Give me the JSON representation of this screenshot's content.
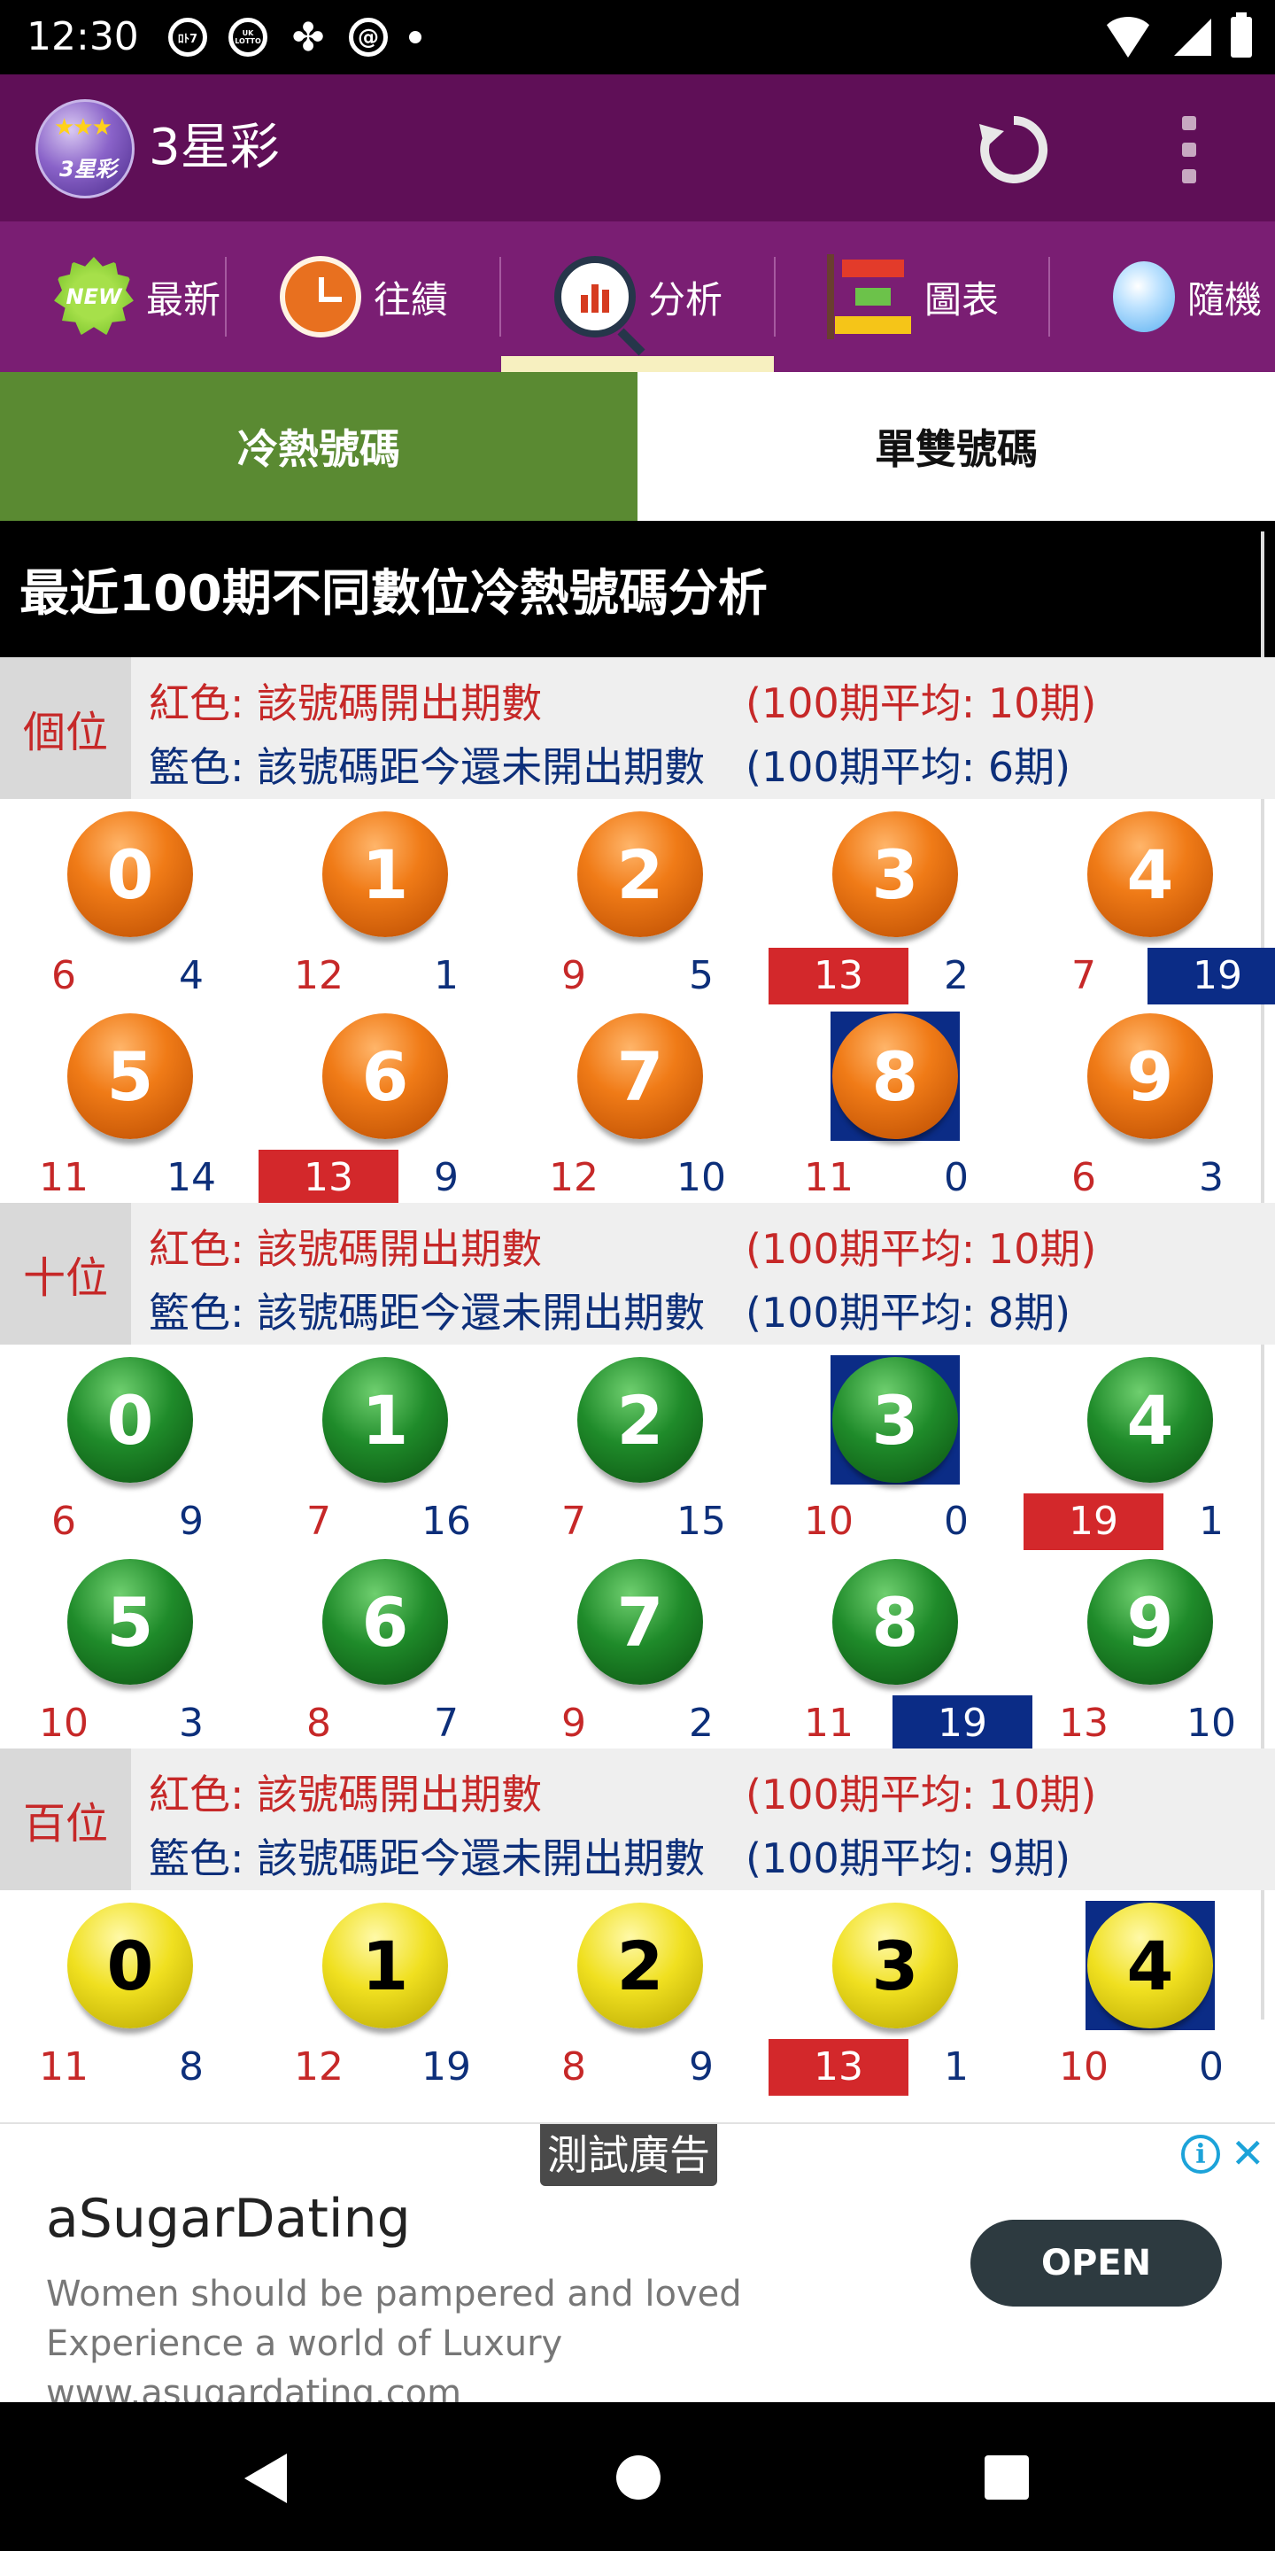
{
  "status": {
    "time": "12:30",
    "left_icons": [
      "lotto-jp-icon",
      "uk-lotto-icon",
      "clover-icon",
      "at-sign-icon",
      "dot-icon"
    ],
    "left_icon_texts": [
      "ﾛﾄ7",
      "UK LOTTO"
    ],
    "right_icons": [
      "wifi-icon",
      "signal-icon",
      "battery-icon"
    ]
  },
  "app_bar": {
    "logo_text": "3星彩",
    "title": "3星彩",
    "actions": [
      "refresh-icon",
      "more-vert-icon"
    ]
  },
  "tabs": [
    {
      "label": "最新",
      "icon": "new-badge-icon",
      "icon_text": "NEW"
    },
    {
      "label": "往績",
      "icon": "clock-icon"
    },
    {
      "label": "分析",
      "icon": "analysis-magnifier-icon",
      "selected": true
    },
    {
      "label": "圖表",
      "icon": "bar-chart-icon"
    },
    {
      "label": "隨機",
      "icon": "lightbulb-icon"
    }
  ],
  "subtabs": {
    "hot_cold": "冷熱號碼",
    "odd_even": "單雙號碼",
    "active": "hot_cold"
  },
  "section_title": "最近100期不同數位冷熱號碼分析",
  "colors": {
    "red": "#c62828",
    "blue": "#0d2f7a",
    "highlight_red": "#d3282b",
    "highlight_blue": "#0b2c86",
    "active_subtab": "#5a8a32",
    "app_bar": "#5f0f57",
    "tab_strip": "#7a1e73"
  },
  "positions": [
    {
      "label": "個位",
      "legend_red": "紅色: 該號碼開出期數",
      "legend_blue": "籃色: 該號碼距今還未開出期數",
      "avg_red": "(100期平均: 10期)",
      "avg_blue": "(100期平均: 6期)",
      "ball_color": "orange",
      "numbers": [
        {
          "digit": "0",
          "drawn": "6",
          "since": "4"
        },
        {
          "digit": "1",
          "drawn": "12",
          "since": "1"
        },
        {
          "digit": "2",
          "drawn": "9",
          "since": "5"
        },
        {
          "digit": "3",
          "drawn": "13",
          "since": "2",
          "hot": true
        },
        {
          "digit": "4",
          "drawn": "7",
          "since": "19",
          "cold": true
        },
        {
          "digit": "5",
          "drawn": "11",
          "since": "14"
        },
        {
          "digit": "6",
          "drawn": "13",
          "since": "9",
          "hot": true
        },
        {
          "digit": "7",
          "drawn": "12",
          "since": "10"
        },
        {
          "digit": "8",
          "drawn": "11",
          "since": "0",
          "latest": true
        },
        {
          "digit": "9",
          "drawn": "6",
          "since": "3"
        }
      ]
    },
    {
      "label": "十位",
      "legend_red": "紅色: 該號碼開出期數",
      "legend_blue": "籃色: 該號碼距今還未開出期數",
      "avg_red": "(100期平均: 10期)",
      "avg_blue": "(100期平均: 8期)",
      "ball_color": "green",
      "numbers": [
        {
          "digit": "0",
          "drawn": "6",
          "since": "9"
        },
        {
          "digit": "1",
          "drawn": "7",
          "since": "16"
        },
        {
          "digit": "2",
          "drawn": "7",
          "since": "15"
        },
        {
          "digit": "3",
          "drawn": "10",
          "since": "0",
          "latest": true
        },
        {
          "digit": "4",
          "drawn": "19",
          "since": "1",
          "hot": true
        },
        {
          "digit": "5",
          "drawn": "10",
          "since": "3"
        },
        {
          "digit": "6",
          "drawn": "8",
          "since": "7"
        },
        {
          "digit": "7",
          "drawn": "9",
          "since": "2"
        },
        {
          "digit": "8",
          "drawn": "11",
          "since": "19",
          "cold": true
        },
        {
          "digit": "9",
          "drawn": "13",
          "since": "10"
        }
      ]
    },
    {
      "label": "百位",
      "legend_red": "紅色: 該號碼開出期數",
      "legend_blue": "籃色: 該號碼距今還未開出期數",
      "avg_red": "(100期平均: 10期)",
      "avg_blue": "(100期平均: 9期)",
      "ball_color": "yellow",
      "numbers": [
        {
          "digit": "0",
          "drawn": "11",
          "since": "8"
        },
        {
          "digit": "1",
          "drawn": "12",
          "since": "19"
        },
        {
          "digit": "2",
          "drawn": "8",
          "since": "9"
        },
        {
          "digit": "3",
          "drawn": "13",
          "since": "1",
          "hot": true
        },
        {
          "digit": "4",
          "drawn": "10",
          "since": "0",
          "latest": true
        }
      ]
    }
  ],
  "ad": {
    "tag": "測試廣告",
    "title": "aSugarDating",
    "body": "Women should be pampered and loved Experience a world of Luxury www.asugardating.com",
    "button": "OPEN",
    "info_icon": "i"
  },
  "nav": [
    "back-icon",
    "home-icon",
    "recents-icon"
  ]
}
